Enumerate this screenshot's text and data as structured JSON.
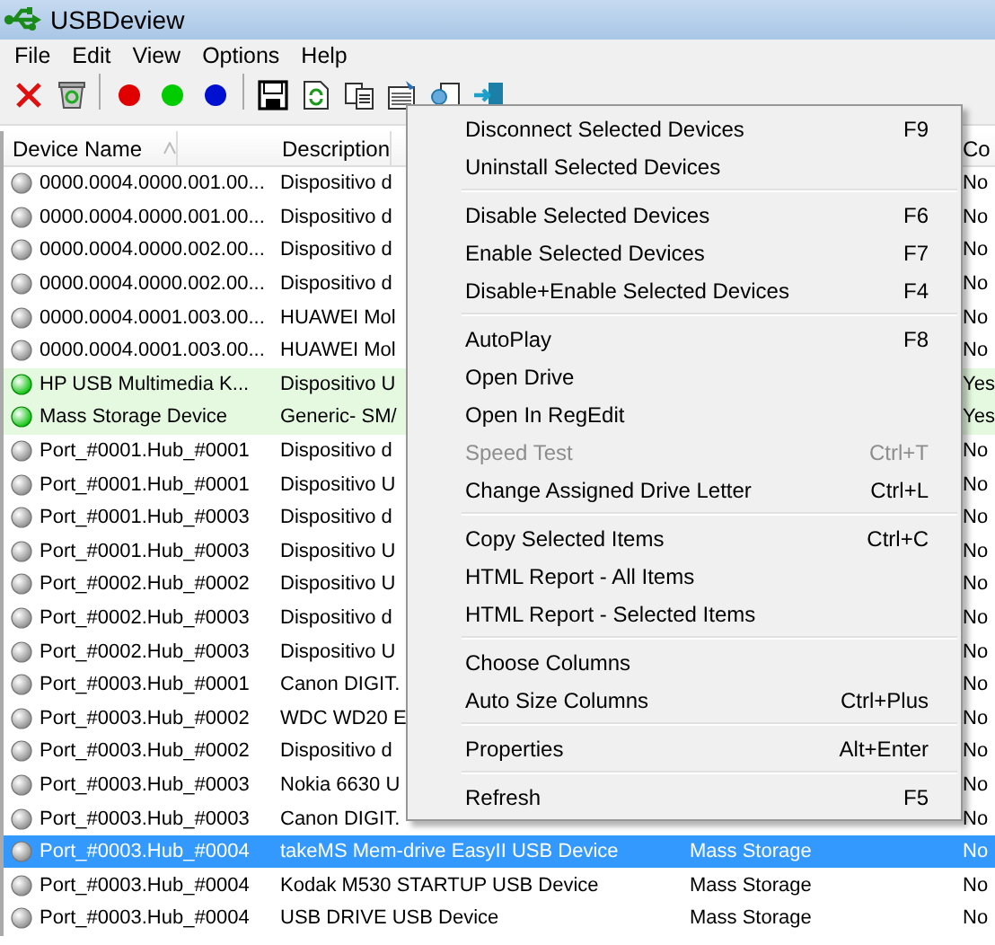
{
  "window": {
    "title": "USBDeview"
  },
  "menu_bar": [
    "File",
    "Edit",
    "View",
    "Options",
    "Help"
  ],
  "toolbar": [
    {
      "kind": "disconnect"
    },
    {
      "kind": "uninstall"
    },
    {
      "kind": "sep"
    },
    {
      "kind": "dot",
      "color": "#e00000"
    },
    {
      "kind": "dot",
      "color": "#00cc00"
    },
    {
      "kind": "dot",
      "color": "#0010d0"
    },
    {
      "kind": "sep"
    },
    {
      "kind": "save"
    },
    {
      "kind": "refresh"
    },
    {
      "kind": "copy"
    },
    {
      "kind": "properties"
    },
    {
      "kind": "report"
    },
    {
      "kind": "exit"
    }
  ],
  "table": {
    "columns": [
      {
        "label": "Device Name",
        "sorted": true
      },
      {
        "label": "Description",
        "sorted": false
      },
      {
        "label": "Co",
        "sorted": false
      }
    ],
    "rows": [
      {
        "name": "0000.0004.0000.001.00...",
        "description": "Dispositivo d",
        "connected_text": "No",
        "connected": false,
        "selected": false
      },
      {
        "name": "0000.0004.0000.001.00...",
        "description": "Dispositivo d",
        "connected_text": "No",
        "connected": false,
        "selected": false
      },
      {
        "name": "0000.0004.0000.002.00...",
        "description": "Dispositivo d",
        "connected_text": "No",
        "connected": false,
        "selected": false
      },
      {
        "name": "0000.0004.0000.002.00...",
        "description": "Dispositivo d",
        "connected_text": "No",
        "connected": false,
        "selected": false
      },
      {
        "name": "0000.0004.0001.003.00...",
        "description": "HUAWEI Mol",
        "connected_text": "No",
        "connected": false,
        "selected": false
      },
      {
        "name": "0000.0004.0001.003.00...",
        "description": "HUAWEI Mol",
        "connected_text": "No",
        "connected": false,
        "selected": false
      },
      {
        "name": "HP USB Multimedia K...",
        "description": "Dispositivo U",
        "connected_text": "Yes",
        "connected": true,
        "selected": false
      },
      {
        "name": "Mass Storage Device",
        "description": "Generic- SM/",
        "connected_text": "Yes",
        "connected": true,
        "selected": false
      },
      {
        "name": "Port_#0001.Hub_#0001",
        "description": "Dispositivo d",
        "connected_text": "No",
        "connected": false,
        "selected": false
      },
      {
        "name": "Port_#0001.Hub_#0001",
        "description": "Dispositivo U",
        "connected_text": "No",
        "connected": false,
        "selected": false
      },
      {
        "name": "Port_#0001.Hub_#0003",
        "description": "Dispositivo d",
        "connected_text": "No",
        "connected": false,
        "selected": false
      },
      {
        "name": "Port_#0001.Hub_#0003",
        "description": "Dispositivo U",
        "connected_text": "No",
        "connected": false,
        "selected": false
      },
      {
        "name": "Port_#0002.Hub_#0002",
        "description": "Dispositivo U",
        "connected_text": "No",
        "connected": false,
        "selected": false
      },
      {
        "name": "Port_#0002.Hub_#0003",
        "description": "Dispositivo d",
        "connected_text": "No",
        "connected": false,
        "selected": false
      },
      {
        "name": "Port_#0002.Hub_#0003",
        "description": "Dispositivo U",
        "connected_text": "No",
        "connected": false,
        "selected": false
      },
      {
        "name": "Port_#0003.Hub_#0001",
        "description": "Canon DIGIT.",
        "connected_text": "No",
        "connected": false,
        "selected": false
      },
      {
        "name": "Port_#0003.Hub_#0002",
        "description": "WDC WD20 E",
        "connected_text": "No",
        "connected": false,
        "selected": false
      },
      {
        "name": "Port_#0003.Hub_#0002",
        "description": "Dispositivo d",
        "connected_text": "No",
        "connected": false,
        "selected": false
      },
      {
        "name": "Port_#0003.Hub_#0003",
        "description": "Nokia 6630 U",
        "connected_text": "No",
        "connected": false,
        "selected": false
      },
      {
        "name": "Port_#0003.Hub_#0003",
        "description": "Canon DIGIT.",
        "connected_text": "No",
        "connected": false,
        "selected": false
      },
      {
        "name": "Port_#0003.Hub_#0004",
        "description": "takeMS Mem-drive EasyII USB Device",
        "type": "Mass Storage",
        "connected_text": "No",
        "connected": false,
        "selected": true
      },
      {
        "name": "Port_#0003.Hub_#0004",
        "description": "Kodak M530 STARTUP USB Device",
        "type": "Mass Storage",
        "connected_text": "No",
        "connected": false,
        "selected": false
      },
      {
        "name": "Port_#0003.Hub_#0004",
        "description": "USB DRIVE USB Device",
        "type": "Mass Storage",
        "connected_text": "No",
        "connected": false,
        "selected": false
      }
    ]
  },
  "context_menu": [
    {
      "kind": "item",
      "label": "Disconnect Selected Devices",
      "shortcut": "F9",
      "disabled": false
    },
    {
      "kind": "item",
      "label": "Uninstall Selected Devices",
      "disabled": false
    },
    {
      "kind": "separator"
    },
    {
      "kind": "item",
      "label": "Disable Selected Devices",
      "shortcut": "F6",
      "disabled": false
    },
    {
      "kind": "item",
      "label": "Enable Selected Devices",
      "shortcut": "F7",
      "disabled": false
    },
    {
      "kind": "item",
      "label": "Disable+Enable Selected Devices",
      "shortcut": "F4",
      "disabled": false
    },
    {
      "kind": "separator"
    },
    {
      "kind": "item",
      "label": "AutoPlay",
      "shortcut": "F8",
      "disabled": false
    },
    {
      "kind": "item",
      "label": "Open Drive",
      "disabled": false
    },
    {
      "kind": "item",
      "label": "Open In RegEdit",
      "disabled": false
    },
    {
      "kind": "item",
      "label": "Speed Test",
      "shortcut": "Ctrl+T",
      "disabled": true
    },
    {
      "kind": "item",
      "label": "Change Assigned Drive Letter",
      "shortcut": "Ctrl+L",
      "disabled": false
    },
    {
      "kind": "separator"
    },
    {
      "kind": "item",
      "label": "Copy Selected Items",
      "shortcut": "Ctrl+C",
      "disabled": false
    },
    {
      "kind": "item",
      "label": "HTML Report - All Items",
      "disabled": false
    },
    {
      "kind": "item",
      "label": "HTML Report - Selected Items",
      "disabled": false
    },
    {
      "kind": "separator"
    },
    {
      "kind": "item",
      "label": "Choose Columns",
      "disabled": false
    },
    {
      "kind": "item",
      "label": "Auto Size Columns",
      "shortcut": "Ctrl+Plus",
      "disabled": false
    },
    {
      "kind": "separator"
    },
    {
      "kind": "item",
      "label": "Properties",
      "shortcut": "Alt+Enter",
      "disabled": false
    },
    {
      "kind": "separator"
    },
    {
      "kind": "item",
      "label": "Refresh",
      "shortcut": "F5",
      "disabled": false
    }
  ]
}
